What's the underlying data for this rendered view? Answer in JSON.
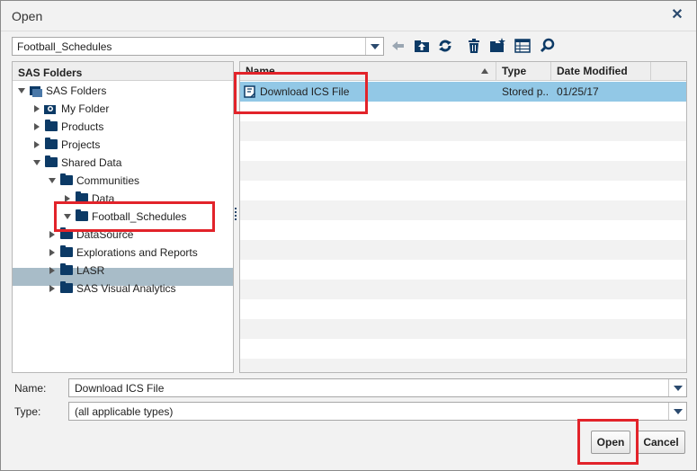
{
  "dialog": {
    "title": "Open",
    "close_glyph": "✕"
  },
  "path": {
    "value": "Football_Schedules"
  },
  "toolbar": {
    "icons": [
      "back-arrow-icon",
      "up-folder-icon",
      "refresh-icon",
      "delete-icon",
      "new-folder-icon",
      "details-view-icon",
      "search-icon"
    ]
  },
  "tree": {
    "header": "SAS Folders",
    "items": [
      {
        "label": "SAS Folders",
        "expanded": true
      },
      {
        "label": "My Folder"
      },
      {
        "label": "Products"
      },
      {
        "label": "Projects"
      },
      {
        "label": "Shared Data",
        "expanded": true
      },
      {
        "label": "Communities",
        "expanded": true
      },
      {
        "label": "Data"
      },
      {
        "label": "Football_Schedules",
        "expanded": true,
        "selected": true
      },
      {
        "label": "DataSource"
      },
      {
        "label": "Explorations and Reports"
      },
      {
        "label": "LASR"
      },
      {
        "label": "SAS Visual Analytics"
      }
    ]
  },
  "files": {
    "columns": [
      "Name",
      "Type",
      "Date Modified"
    ],
    "rows": [
      {
        "name": "Download ICS File",
        "type": "Stored p...",
        "date": "01/25/17",
        "selected": true
      }
    ]
  },
  "form": {
    "name_label": "Name:",
    "name_value": "Download ICS File",
    "type_label": "Type:",
    "type_value": "(all applicable types)"
  },
  "buttons": {
    "open": "Open",
    "cancel": "Cancel"
  },
  "colors": {
    "selection_row": "#92c8e6",
    "tree_selection": "#a8bcc8",
    "folder": "#0c3a66",
    "highlight_box": "#e2232a"
  }
}
